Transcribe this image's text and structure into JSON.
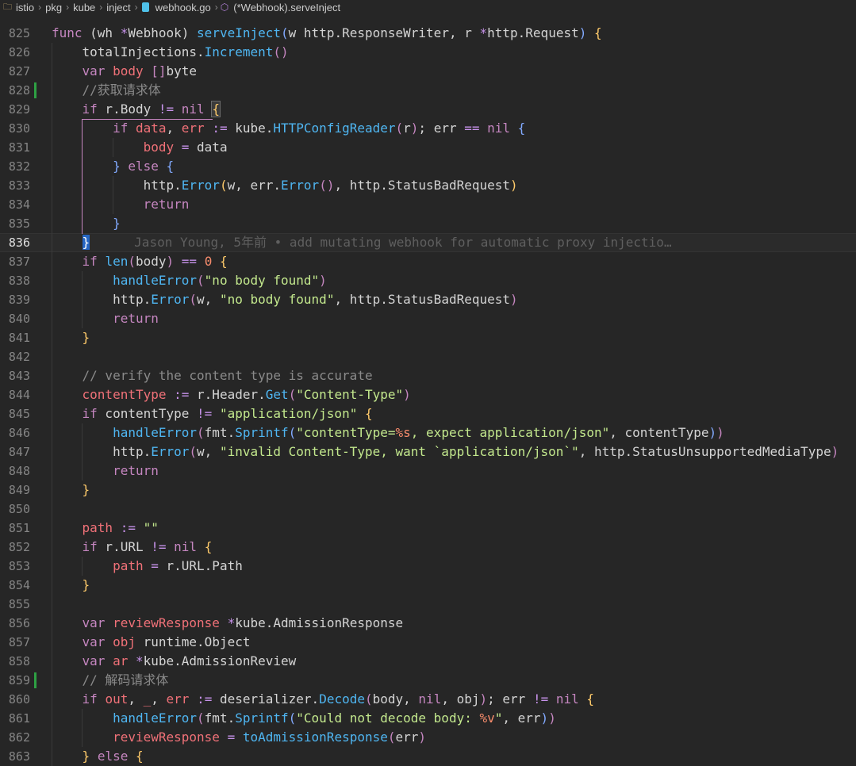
{
  "breadcrumb": {
    "items": [
      "istio",
      "pkg",
      "kube",
      "inject",
      "webhook.go",
      "(*Webhook).serveInject"
    ]
  },
  "blame": {
    "text": "Jason Young, 5年前 • add mutating webhook for automatic proxy injectio…"
  },
  "lines": [
    {
      "n": "825",
      "tokens": [
        [
          "kw",
          "func"
        ],
        [
          "p",
          " (wh "
        ],
        [
          "op",
          "*"
        ],
        [
          "p",
          "Webhook) "
        ],
        [
          "fn",
          "serveInject"
        ],
        [
          "b",
          "("
        ],
        [
          "p",
          "w http.ResponseWriter, r "
        ],
        [
          "op",
          "*"
        ],
        [
          "p",
          "http.Request"
        ],
        [
          "b",
          ")"
        ],
        [
          "p",
          " "
        ],
        [
          "y",
          "{"
        ]
      ]
    },
    {
      "n": "826",
      "tokens": [
        [
          "p",
          "    totalInjections."
        ],
        [
          "fn",
          "Increment"
        ],
        [
          "kw",
          "()"
        ]
      ]
    },
    {
      "n": "827",
      "tokens": [
        [
          "p",
          "    "
        ],
        [
          "kw",
          "var"
        ],
        [
          "p",
          " "
        ],
        [
          "var",
          "body"
        ],
        [
          "p",
          " "
        ],
        [
          "kw",
          "[]"
        ],
        [
          "p",
          "byte"
        ]
      ]
    },
    {
      "n": "828",
      "tokens": [
        [
          "cm",
          "    //获取请求体"
        ]
      ]
    },
    {
      "n": "829",
      "tokens": [
        [
          "p",
          "    "
        ],
        [
          "kw",
          "if"
        ],
        [
          "p",
          " r.Body "
        ],
        [
          "op",
          "!="
        ],
        [
          "p",
          " "
        ],
        [
          "kw",
          "nil"
        ],
        [
          "p",
          " "
        ],
        [
          "y",
          "{"
        ]
      ]
    },
    {
      "n": "830",
      "tokens": [
        [
          "p",
          "        "
        ],
        [
          "kw",
          "if"
        ],
        [
          "p",
          " "
        ],
        [
          "var",
          "data"
        ],
        [
          "p",
          ", "
        ],
        [
          "var",
          "err"
        ],
        [
          "p",
          " "
        ],
        [
          "op",
          ":="
        ],
        [
          "p",
          " kube."
        ],
        [
          "fn",
          "HTTPConfigReader"
        ],
        [
          "kw",
          "("
        ],
        [
          "p",
          "r"
        ],
        [
          "kw",
          ")"
        ],
        [
          "p",
          "; err "
        ],
        [
          "op",
          "=="
        ],
        [
          "p",
          " "
        ],
        [
          "kw",
          "nil"
        ],
        [
          "p",
          " "
        ],
        [
          "b",
          "{"
        ]
      ]
    },
    {
      "n": "831",
      "tokens": [
        [
          "p",
          "            "
        ],
        [
          "var",
          "body"
        ],
        [
          "p",
          " "
        ],
        [
          "op",
          "="
        ],
        [
          "p",
          " data"
        ]
      ]
    },
    {
      "n": "832",
      "tokens": [
        [
          "p",
          "        "
        ],
        [
          "b",
          "}"
        ],
        [
          "p",
          " "
        ],
        [
          "kw",
          "else"
        ],
        [
          "p",
          " "
        ],
        [
          "b",
          "{"
        ]
      ]
    },
    {
      "n": "833",
      "tokens": [
        [
          "p",
          "            http."
        ],
        [
          "fn",
          "Error"
        ],
        [
          "y",
          "("
        ],
        [
          "p",
          "w, err."
        ],
        [
          "fn",
          "Error"
        ],
        [
          "kw",
          "()"
        ],
        [
          "p",
          ", http.StatusBadRequest"
        ],
        [
          "y",
          ")"
        ]
      ]
    },
    {
      "n": "834",
      "tokens": [
        [
          "p",
          "            "
        ],
        [
          "kw",
          "return"
        ]
      ]
    },
    {
      "n": "835",
      "tokens": [
        [
          "p",
          "        "
        ],
        [
          "b",
          "}"
        ]
      ]
    },
    {
      "n": "836",
      "tokens": [
        [
          "p",
          "    "
        ],
        [
          "cur",
          "}"
        ]
      ],
      "current": true
    },
    {
      "n": "837",
      "tokens": [
        [
          "p",
          "    "
        ],
        [
          "kw",
          "if"
        ],
        [
          "p",
          " "
        ],
        [
          "fn",
          "len"
        ],
        [
          "kw",
          "("
        ],
        [
          "p",
          "body"
        ],
        [
          "kw",
          ")"
        ],
        [
          "p",
          " "
        ],
        [
          "op",
          "=="
        ],
        [
          "p",
          " "
        ],
        [
          "num",
          "0"
        ],
        [
          "p",
          " "
        ],
        [
          "y",
          "{"
        ]
      ]
    },
    {
      "n": "838",
      "tokens": [
        [
          "p",
          "        "
        ],
        [
          "fn",
          "handleError"
        ],
        [
          "kw",
          "("
        ],
        [
          "str",
          "\"no body found\""
        ],
        [
          "kw",
          ")"
        ]
      ]
    },
    {
      "n": "839",
      "tokens": [
        [
          "p",
          "        http."
        ],
        [
          "fn",
          "Error"
        ],
        [
          "kw",
          "("
        ],
        [
          "p",
          "w, "
        ],
        [
          "str",
          "\"no body found\""
        ],
        [
          "p",
          ", http.StatusBadRequest"
        ],
        [
          "kw",
          ")"
        ]
      ]
    },
    {
      "n": "840",
      "tokens": [
        [
          "p",
          "        "
        ],
        [
          "kw",
          "return"
        ]
      ]
    },
    {
      "n": "841",
      "tokens": [
        [
          "p",
          "    "
        ],
        [
          "y",
          "}"
        ]
      ]
    },
    {
      "n": "842",
      "tokens": []
    },
    {
      "n": "843",
      "tokens": [
        [
          "cm",
          "    // verify the content type is accurate"
        ]
      ]
    },
    {
      "n": "844",
      "tokens": [
        [
          "p",
          "    "
        ],
        [
          "var",
          "contentType"
        ],
        [
          "p",
          " "
        ],
        [
          "op",
          ":="
        ],
        [
          "p",
          " r.Header."
        ],
        [
          "fn",
          "Get"
        ],
        [
          "kw",
          "("
        ],
        [
          "str",
          "\"Content-Type\""
        ],
        [
          "kw",
          ")"
        ]
      ]
    },
    {
      "n": "845",
      "tokens": [
        [
          "p",
          "    "
        ],
        [
          "kw",
          "if"
        ],
        [
          "p",
          " contentType "
        ],
        [
          "op",
          "!="
        ],
        [
          "p",
          " "
        ],
        [
          "str",
          "\"application/json\""
        ],
        [
          "p",
          " "
        ],
        [
          "y",
          "{"
        ]
      ]
    },
    {
      "n": "846",
      "tokens": [
        [
          "p",
          "        "
        ],
        [
          "fn",
          "handleError"
        ],
        [
          "kw",
          "("
        ],
        [
          "p",
          "fmt."
        ],
        [
          "fn",
          "Sprintf"
        ],
        [
          "b",
          "("
        ],
        [
          "str",
          "\"contentType="
        ],
        [
          "num",
          "%s"
        ],
        [
          "str",
          ", expect application/json\""
        ],
        [
          "p",
          ", contentType"
        ],
        [
          "b",
          ")"
        ],
        [
          "kw",
          ")"
        ]
      ]
    },
    {
      "n": "847",
      "tokens": [
        [
          "p",
          "        http."
        ],
        [
          "fn",
          "Error"
        ],
        [
          "kw",
          "("
        ],
        [
          "p",
          "w, "
        ],
        [
          "str",
          "\"invalid Content-Type, want `application/json`\""
        ],
        [
          "p",
          ", http.StatusUnsupportedMediaType"
        ],
        [
          "kw",
          ")"
        ]
      ]
    },
    {
      "n": "848",
      "tokens": [
        [
          "p",
          "        "
        ],
        [
          "kw",
          "return"
        ]
      ]
    },
    {
      "n": "849",
      "tokens": [
        [
          "p",
          "    "
        ],
        [
          "y",
          "}"
        ]
      ]
    },
    {
      "n": "850",
      "tokens": []
    },
    {
      "n": "851",
      "tokens": [
        [
          "p",
          "    "
        ],
        [
          "var",
          "path"
        ],
        [
          "p",
          " "
        ],
        [
          "op",
          ":="
        ],
        [
          "p",
          " "
        ],
        [
          "str",
          "\"\""
        ]
      ]
    },
    {
      "n": "852",
      "tokens": [
        [
          "p",
          "    "
        ],
        [
          "kw",
          "if"
        ],
        [
          "p",
          " r.URL "
        ],
        [
          "op",
          "!="
        ],
        [
          "p",
          " "
        ],
        [
          "kw",
          "nil"
        ],
        [
          "p",
          " "
        ],
        [
          "y",
          "{"
        ]
      ]
    },
    {
      "n": "853",
      "tokens": [
        [
          "p",
          "        "
        ],
        [
          "var",
          "path"
        ],
        [
          "p",
          " "
        ],
        [
          "op",
          "="
        ],
        [
          "p",
          " r.URL.Path"
        ]
      ]
    },
    {
      "n": "854",
      "tokens": [
        [
          "p",
          "    "
        ],
        [
          "y",
          "}"
        ]
      ]
    },
    {
      "n": "855",
      "tokens": []
    },
    {
      "n": "856",
      "tokens": [
        [
          "p",
          "    "
        ],
        [
          "kw",
          "var"
        ],
        [
          "p",
          " "
        ],
        [
          "var",
          "reviewResponse"
        ],
        [
          "p",
          " "
        ],
        [
          "op",
          "*"
        ],
        [
          "p",
          "kube.AdmissionResponse"
        ]
      ]
    },
    {
      "n": "857",
      "tokens": [
        [
          "p",
          "    "
        ],
        [
          "kw",
          "var"
        ],
        [
          "p",
          " "
        ],
        [
          "var",
          "obj"
        ],
        [
          "p",
          " runtime.Object"
        ]
      ]
    },
    {
      "n": "858",
      "tokens": [
        [
          "p",
          "    "
        ],
        [
          "kw",
          "var"
        ],
        [
          "p",
          " "
        ],
        [
          "var",
          "ar"
        ],
        [
          "p",
          " "
        ],
        [
          "op",
          "*"
        ],
        [
          "p",
          "kube.AdmissionReview"
        ]
      ]
    },
    {
      "n": "859",
      "tokens": [
        [
          "cm",
          "    // 解码请求体"
        ]
      ]
    },
    {
      "n": "860",
      "tokens": [
        [
          "p",
          "    "
        ],
        [
          "kw",
          "if"
        ],
        [
          "p",
          " "
        ],
        [
          "var",
          "out"
        ],
        [
          "p",
          ", "
        ],
        [
          "var",
          "_"
        ],
        [
          "p",
          ", "
        ],
        [
          "var",
          "err"
        ],
        [
          "p",
          " "
        ],
        [
          "op",
          ":="
        ],
        [
          "p",
          " deserializer."
        ],
        [
          "fn",
          "Decode"
        ],
        [
          "kw",
          "("
        ],
        [
          "p",
          "body, "
        ],
        [
          "kw",
          "nil"
        ],
        [
          "p",
          ", obj"
        ],
        [
          "kw",
          ")"
        ],
        [
          "p",
          "; err "
        ],
        [
          "op",
          "!="
        ],
        [
          "p",
          " "
        ],
        [
          "kw",
          "nil"
        ],
        [
          "p",
          " "
        ],
        [
          "y",
          "{"
        ]
      ]
    },
    {
      "n": "861",
      "tokens": [
        [
          "p",
          "        "
        ],
        [
          "fn",
          "handleError"
        ],
        [
          "kw",
          "("
        ],
        [
          "p",
          "fmt."
        ],
        [
          "fn",
          "Sprintf"
        ],
        [
          "b",
          "("
        ],
        [
          "str",
          "\"Could not decode body: "
        ],
        [
          "num",
          "%v"
        ],
        [
          "str",
          "\""
        ],
        [
          "p",
          ", err"
        ],
        [
          "b",
          ")"
        ],
        [
          "kw",
          ")"
        ]
      ]
    },
    {
      "n": "862",
      "tokens": [
        [
          "p",
          "        "
        ],
        [
          "var",
          "reviewResponse"
        ],
        [
          "p",
          " "
        ],
        [
          "op",
          "="
        ],
        [
          "p",
          " "
        ],
        [
          "fn",
          "toAdmissionResponse"
        ],
        [
          "kw",
          "("
        ],
        [
          "p",
          "err"
        ],
        [
          "kw",
          ")"
        ]
      ]
    },
    {
      "n": "863",
      "tokens": [
        [
          "p",
          "    "
        ],
        [
          "y",
          "}"
        ],
        [
          "p",
          " "
        ],
        [
          "kw",
          "else"
        ],
        [
          "p",
          " "
        ],
        [
          "y",
          "{"
        ]
      ]
    }
  ],
  "modified_lines": [
    "828",
    "859"
  ],
  "colors": {
    "background": "#262626",
    "keyword": "#c586c0",
    "function": "#4fb6f2",
    "variable": "#f07178",
    "string": "#c3e88d",
    "number": "#f78c6c",
    "comment": "#8a8a8a",
    "git_added": "#2ea043"
  }
}
